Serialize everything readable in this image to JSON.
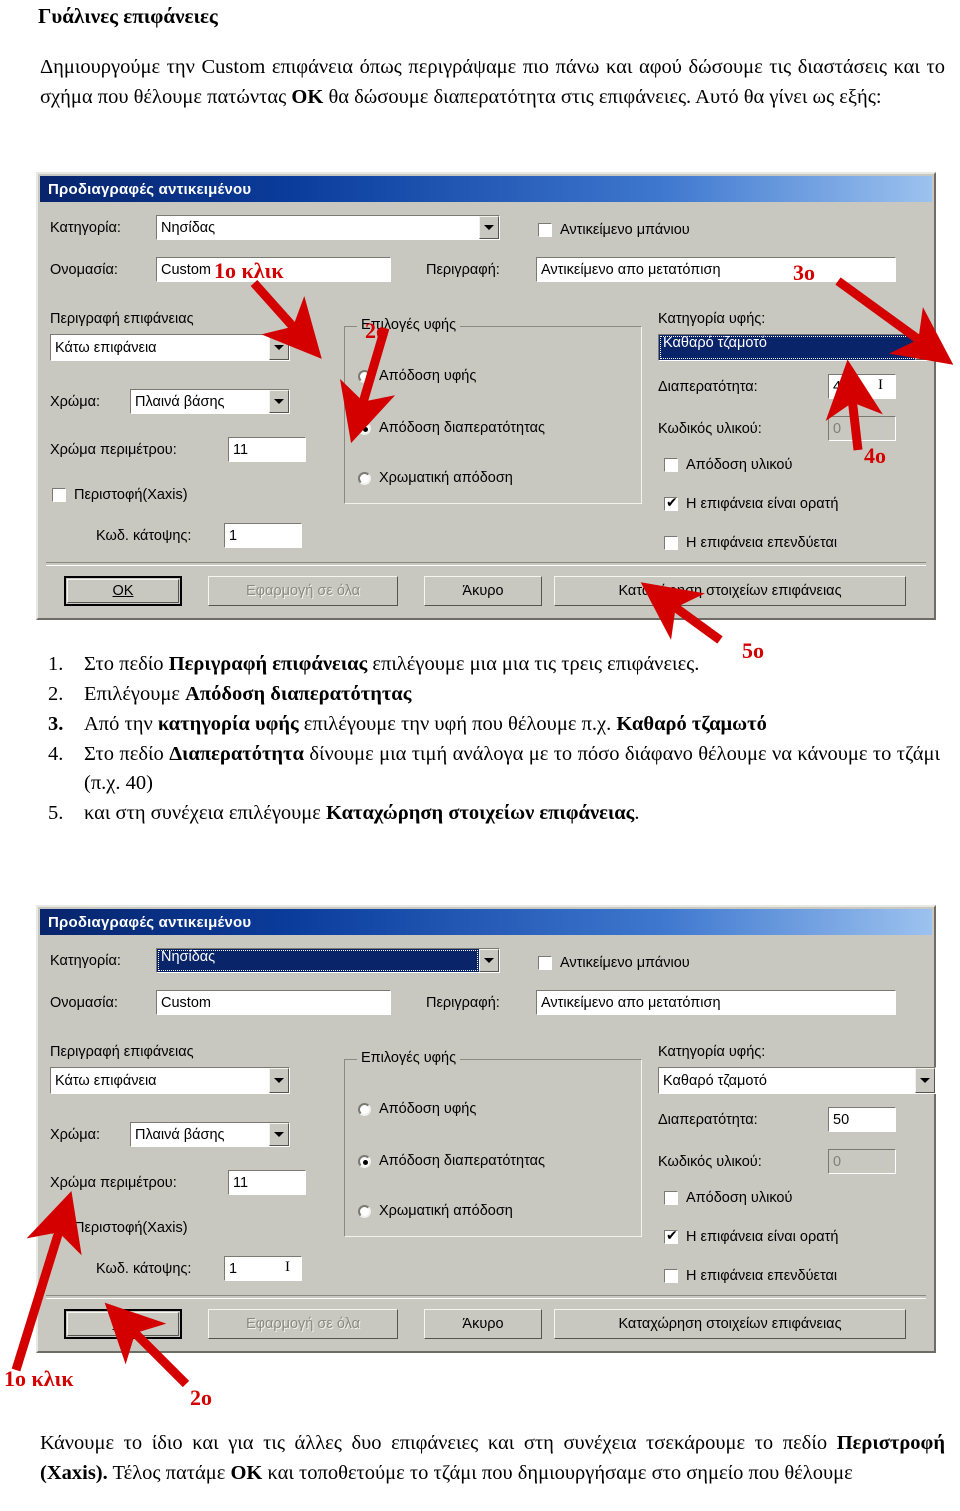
{
  "document": {
    "title": "Γυάλινες επιφάνειες",
    "intro": "Δημιουργούμε την Custom επιφάνεια όπως περιγράψαμε πιο πάνω και αφού δώσουμε τις διαστάσεις και το σχήμα που θέλουμε πατώντας ΟΚ θα δώσουμε διαπερατότητα στις επιφάνειες. Αυτό θα γίνει ως εξής:",
    "outro": "Κάνουμε το ίδιο και για τις άλλες δυο επιφάνειες και στη συνέχεια τσεκάρουμε το πεδίο Περιστροφή (Xaxis). Τέλος πατάμε ΟΚ και τοποθετούμε το τζάμι που δημιουργήσαμε στο σημείο που θέλουμε"
  },
  "steps": [
    {
      "num": "1.",
      "text_a": "Στο πεδίο ",
      "bold_a": "Περιγραφή επιφάνειας",
      "text_b": " επιλέγουμε μια μια τις τρεις επιφάνειες."
    },
    {
      "num": "2.",
      "text_a": "Επιλέγουμε ",
      "bold_a": "Απόδοση διαπερατότητας",
      "text_b": ""
    },
    {
      "num": "3.",
      "text_a": "Από την ",
      "bold_a": "κατηγορία υφής",
      "text_b": " επιλέγουμε την υφή που θέλουμε π.χ. ",
      "bold_b": "Καθαρό τζαμωτό"
    },
    {
      "num": "4.",
      "text_a": "Στο πεδίο ",
      "bold_a": "Διαπερατότητα",
      "text_b": " δίνουμε μια τιμή ανάλογα με το πόσο διάφανο θέλουμε να κάνουμε το τζάμι (π.χ. 40)"
    },
    {
      "num": "5.",
      "text_a": "και στη συνέχεια επιλέγουμε ",
      "bold_a": "Καταχώρηση στοιχείων επιφάνειας",
      "text_b": "."
    }
  ],
  "dialog1": {
    "title": "Προδιαγραφές αντικειμένου",
    "label_category": "Κατηγορία:",
    "value_category": "Νησίδας",
    "label_name": "Ονομασία:",
    "value_name": "Custom",
    "label_description": "Περιγραφή:",
    "value_description": "Αντικείμενο απο μετατόπιση",
    "check_bath": "Αντικείμενο μπάνιου",
    "label_surface_desc": "Περιγραφή επιφάνειας",
    "value_surface_desc": "Κάτω επιφάνεια",
    "label_color": "Χρώμα:",
    "value_color": "Πλαινά βάσης",
    "label_perimeter_color": "Χρώμα περιμέτρου:",
    "value_perimeter_color": "11",
    "check_rotation": "Περιστοφή(Xaxis)",
    "label_plan_code": "Κωδ. κάτοψης:",
    "value_plan_code": "1",
    "group_texture": "Επιλογές υφής",
    "radio_texture": "Απόδοση υφής",
    "radio_transparency": "Απόδοση διαπερατότητας",
    "radio_color": "Χρωματική απόδοση",
    "label_texture_cat": "Κατηγορία υφής:",
    "value_texture_cat": "Καθαρό τζαμοτό",
    "label_transparency": "Διαπερατότητα:",
    "value_transparency": "40",
    "label_material_code": "Κωδικός υλικού:",
    "value_material_code": "0",
    "check_material": "Απόδοση υλικού",
    "check_visible": "Η επιφάνεια είναι ορατή",
    "check_coated": "Η επιφάνεια επενδύεται",
    "btn_ok": "OK",
    "btn_apply_all": "Εφαρμογή σε όλα",
    "btn_cancel": "Άκυρο",
    "btn_register": "Καταχώρηση στοιχείων επιφάνειας"
  },
  "dialog2": {
    "title": "Προδιαγραφές αντικειμένου",
    "label_category": "Κατηγορία:",
    "value_category": "Νησίδας",
    "label_name": "Ονομασία:",
    "value_name": "Custom",
    "label_description": "Περιγραφή:",
    "value_description": "Αντικείμενο απο μετατόπιση",
    "check_bath": "Αντικείμενο μπάνιου",
    "label_surface_desc": "Περιγραφή επιφάνειας",
    "value_surface_desc": "Κάτω επιφάνεια",
    "label_color": "Χρώμα:",
    "value_color": "Πλαινά βάσης",
    "label_perimeter_color": "Χρώμα περιμέτρου:",
    "value_perimeter_color": "11",
    "check_rotation": "Περιστοφή(Xaxis)",
    "label_plan_code": "Κωδ. κάτοψης:",
    "value_plan_code": "1",
    "group_texture": "Επιλογές υφής",
    "radio_texture": "Απόδοση υφής",
    "radio_transparency": "Απόδοση διαπερατότητας",
    "radio_color": "Χρωματική απόδοση",
    "label_texture_cat": "Κατηγορία υφής:",
    "value_texture_cat": "Καθαρό τζαμοτό",
    "label_transparency": "Διαπερατότητα:",
    "value_transparency": "50",
    "label_material_code": "Κωδικός υλικού:",
    "value_material_code": "0",
    "check_material": "Απόδοση υλικού",
    "check_visible": "Η επιφάνεια είναι ορατή",
    "check_coated": "Η επιφάνεια επενδύεται",
    "btn_ok": "OK",
    "btn_apply_all": "Εφαρμογή σε όλα",
    "btn_cancel": "Άκυρο",
    "btn_register": "Καταχώρηση στοιχείων επιφάνειας"
  },
  "annotations": {
    "a1": "1ο κλικ",
    "a2": "2ο",
    "a3": "3ο",
    "a4": "4ο",
    "a5": "5ο",
    "b1": "1ο κλικ",
    "b2": "2ο",
    "color": "#d40000"
  }
}
